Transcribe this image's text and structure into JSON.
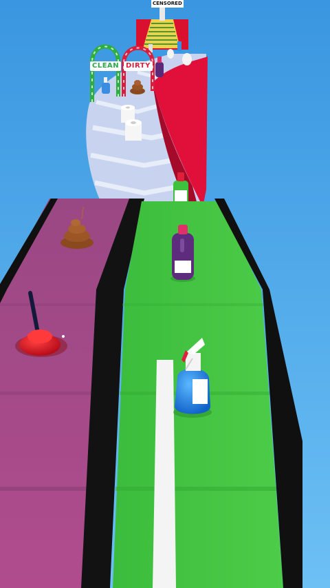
{
  "gates": {
    "clean_label": "CLEAN",
    "dirty_label": "DIRTY"
  },
  "top_sign": {
    "label": "CENSORED"
  },
  "lanes": [
    "dirty-lane",
    "clean-lane"
  ],
  "colors": {
    "sky": "#3fa0e6",
    "clean_lane": "#42c442",
    "dirty_lane": "#a04a88",
    "lane_border": "#111111",
    "red_ramp": "#e0103a",
    "track_far": "#c9d6f0"
  },
  "items": [
    "toilet-paper-roll",
    "poop",
    "plunger",
    "spray-bottle",
    "purple-bottle",
    "green-bottle"
  ]
}
